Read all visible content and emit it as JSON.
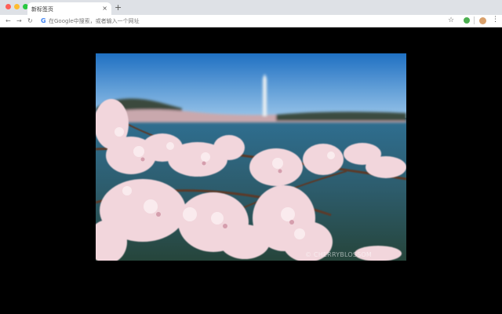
{
  "browser": {
    "tab_title": "新标签页",
    "tab_close": "×",
    "new_tab": "+",
    "nav": {
      "back": "←",
      "forward": "→",
      "reload": "↻"
    },
    "search_engine_badge": "G",
    "omnibox_placeholder": "在Google中搜索，或者输入一个网址",
    "bookmark_star": "☆",
    "menu": "⋮",
    "colors": {
      "close": "#ff5f57",
      "minimize": "#febc2e",
      "zoom": "#28c840",
      "extension": "#4caf50"
    }
  },
  "background_photo": {
    "subject": "cherry blossoms in front of the Washington Monument",
    "watermark": "© CHERRYBLOSSOM"
  }
}
